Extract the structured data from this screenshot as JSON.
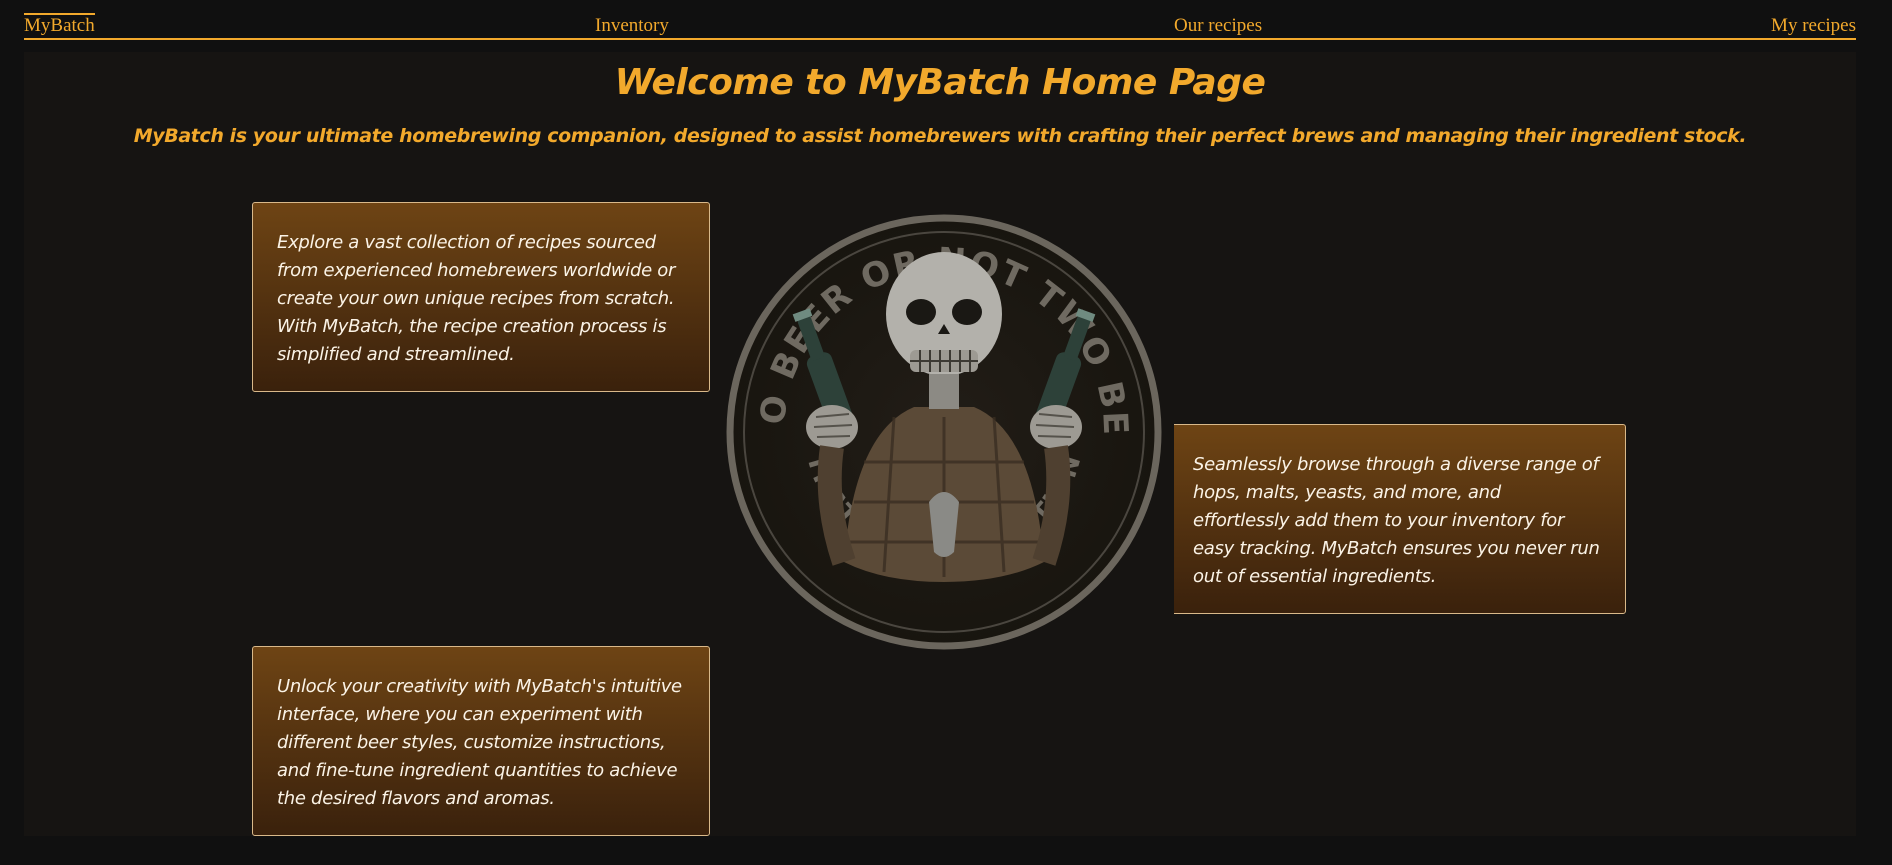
{
  "nav": {
    "brand": "MyBatch",
    "inventory": "Inventory",
    "our_recipes": "Our recipes",
    "my_recipes": "My recipes"
  },
  "hero": {
    "title": "Welcome to MyBatch Home Page",
    "subtitle": "MyBatch is your ultimate homebrewing companion, designed to assist homebrewers with crafting their perfect brews and managing their ingredient stock."
  },
  "cards": [
    {
      "text": "Explore a vast collection of recipes sourced from experienced homebrewers worldwide or create your own unique recipes from scratch. With MyBatch, the recipe creation process is simplified and streamlined."
    },
    {
      "text": "Seamlessly browse through a diverse range of hops, malts, yeasts, and more, and effortlessly add them to your inventory for easy tracking. MyBatch ensures you never run out of essential ingredients."
    },
    {
      "text": "Unlock your creativity with MyBatch's intuitive interface, where you can experiment with different beer styles, customize instructions, and fine-tune ingredient quantities to achieve the desired flavors and aromas."
    }
  ],
  "logo": {
    "icon": "skeleton-beer-badge",
    "top_text": "TWO BEER OR NOT TWO BEER",
    "bottom_text": "THAT IS THE QUESTION"
  },
  "colors": {
    "accent": "#f2a92c",
    "background": "#101010",
    "panel": "#161412",
    "card_top": "#6e4414",
    "card_bottom": "#3a210c"
  }
}
